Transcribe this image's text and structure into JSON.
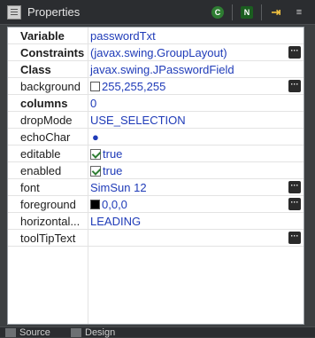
{
  "window": {
    "title": "Properties"
  },
  "toolbar": [
    {
      "name": "show-events-button",
      "glyph": "C"
    },
    {
      "name": "show-advanced-button",
      "glyph": "N"
    },
    {
      "name": "goto-definition-button",
      "glyph": "⇥"
    },
    {
      "name": "menu-button",
      "glyph": "≡"
    }
  ],
  "properties": [
    {
      "name": "Variable",
      "value": "passwordTxt",
      "bold": true
    },
    {
      "name": "Constraints",
      "value": "(javax.swing.GroupLayout)",
      "bold": true,
      "ellipsis": true
    },
    {
      "name": "Class",
      "value": "javax.swing.JPasswordField",
      "bold": true
    },
    {
      "name": "background",
      "value": "255,255,255",
      "swatch": "#ffffff",
      "ellipsis": true
    },
    {
      "name": "columns",
      "value": "0",
      "bold": true
    },
    {
      "name": "dropMode",
      "value": "USE_SELECTION"
    },
    {
      "name": "echoChar",
      "value": "●"
    },
    {
      "name": "editable",
      "value": "true",
      "check": true
    },
    {
      "name": "enabled",
      "value": "true",
      "check": true
    },
    {
      "name": "font",
      "value": "SimSun 12",
      "ellipsis": true
    },
    {
      "name": "foreground",
      "value": "0,0,0",
      "swatch": "#000000",
      "ellipsis": true
    },
    {
      "name": "horizontal...",
      "value": "LEADING"
    },
    {
      "name": "toolTipText",
      "value": "",
      "ellipsis": true
    }
  ],
  "bottom_tabs": [
    {
      "label": "Source"
    },
    {
      "label": "Design"
    }
  ]
}
